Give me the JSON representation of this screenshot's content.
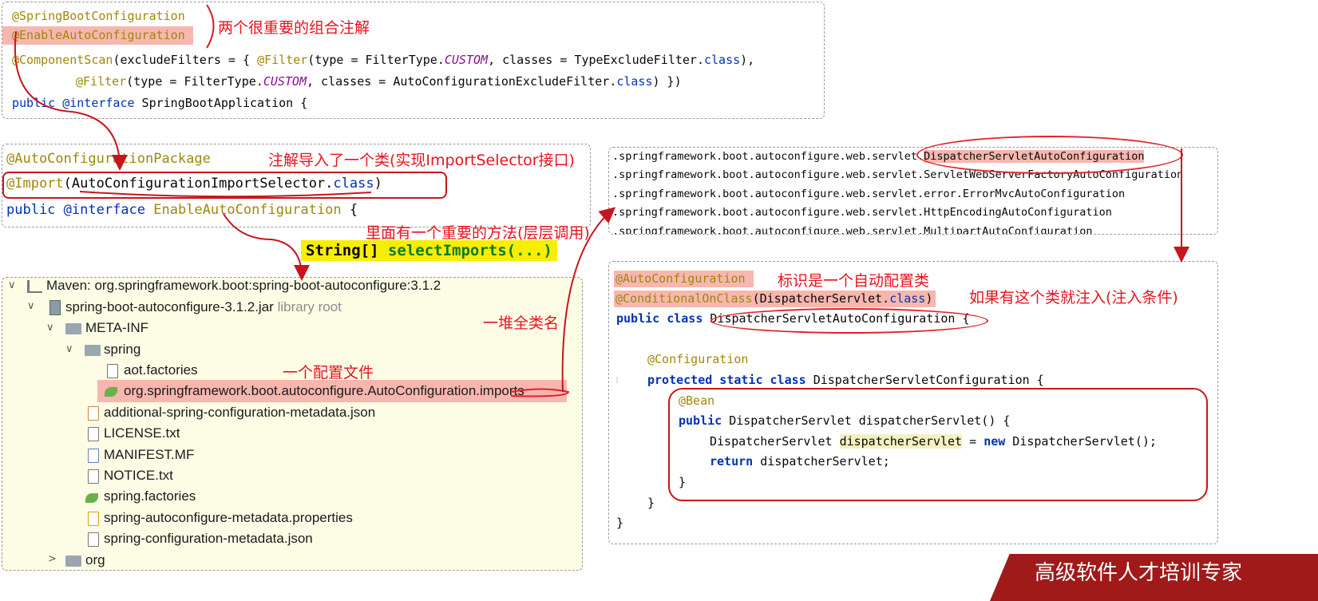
{
  "panel1": {
    "line1": "@SpringBootConfiguration",
    "line2": "@EnableAutoConfiguration",
    "line3_a": "@ComponentScan",
    "line3_b": "(excludeFilters = { ",
    "line3_c": "@Filter",
    "line3_d": "(type = FilterType.",
    "line3_e": "CUSTOM",
    "line3_f": ", classes = TypeExcludeFilter.",
    "line3_g": "class",
    "line3_h": "),",
    "line4_a": "@Filter",
    "line4_b": "(type = FilterType.",
    "line4_c": "CUSTOM",
    "line4_d": ", classes = AutoConfigurationExcludeFilter.",
    "line4_e": "class",
    "line4_f": ") })",
    "line5_a": "public",
    "line5_b": " @interface",
    "line5_c": " SpringBootApplication {",
    "note": "两个很重要的组合注解"
  },
  "panel2": {
    "line1": "@AutoConfigurationPackage",
    "line2_a": "@Import",
    "line2_b": "(AutoConfigurationImportSelector.",
    "line2_c": "class",
    "line2_d": ")",
    "line3_a": "public",
    "line3_b": " @interface",
    "line3_c": " EnableAutoConfiguration",
    "line3_d": " {",
    "note": "注解导入了一个类(实现ImportSelector接口)"
  },
  "method_note": "里面有一个重要的方法(层层调用)",
  "method_sig_a": "String[] ",
  "method_sig_b": "selectImports(...)",
  "tree": {
    "root": "Maven: org.springframework.boot:spring-boot-autoconfigure:3.1.2",
    "jar": "spring-boot-autoconfigure-3.1.2.jar",
    "jar_suffix": "library root",
    "meta_inf": "META-INF",
    "spring": "spring",
    "aot": "aot.factories",
    "imports": "org.springframework.boot.autoconfigure.AutoConfiguration.imports",
    "additional": "additional-spring-configuration-metadata.json",
    "license": "LICENSE.txt",
    "manifest": "MANIFEST.MF",
    "notice": "NOTICE.txt",
    "factories": "spring.factories",
    "props": "spring-autoconfigure-metadata.properties",
    "metadata": "spring-configuration-metadata.json",
    "org": "org",
    "note_config": "一个配置文件",
    "note_names": "一堆全类名"
  },
  "imports_list": [
    ".springframework.boot.autoconfigure.web.servlet.",
    ".springframework.boot.autoconfigure.web.servlet.ServletWebServerFactoryAutoConfiguration",
    ".springframework.boot.autoconfigure.web.servlet.error.ErrorMvcAutoConfiguration",
    ".springframework.boot.autoconfigure.web.servlet.HttpEncodingAutoConfiguration",
    ".springframework.boot.autoconfigure.web.servlet.MultipartAutoConfiguration"
  ],
  "imports_highlight": "DispatcherServletAutoConfiguration",
  "panel4": {
    "ann1": "@AutoConfiguration",
    "note1": "标识是一个自动配置类",
    "ann2_a": "@ConditionalOnClass",
    "ann2_b": "(DispatcherServlet.",
    "ann2_c": "class",
    "ann2_d": ")",
    "note2": "如果有这个类就注入(注入条件)",
    "cls_a": "public class",
    "cls_b": " DispatcherServletAutoConfiguration",
    "cls_c": " {",
    "cfg": "@Configuration",
    "inner_a": "protected static class",
    "inner_b": " DispatcherServletConfiguration {",
    "bean": "@Bean",
    "m1_a": "public",
    "m1_b": " DispatcherServlet dispatcherServlet() {",
    "m2_a": "DispatcherServlet ",
    "m2_b": "dispatcherServlet",
    "m2_c": " = ",
    "m2_d": "new",
    "m2_e": " DispatcherServlet();",
    "m3_a": "return",
    "m3_b": " dispatcherServlet;",
    "close1": "}",
    "close2": "}",
    "close3": "}"
  },
  "banner": "高级软件人才培训专家",
  "colors": {
    "annotation_red": "#e8131f",
    "highlight_pink": "#f7b7ae",
    "tree_bg": "#fdfde6",
    "method_yellow": "#f8ee00"
  }
}
